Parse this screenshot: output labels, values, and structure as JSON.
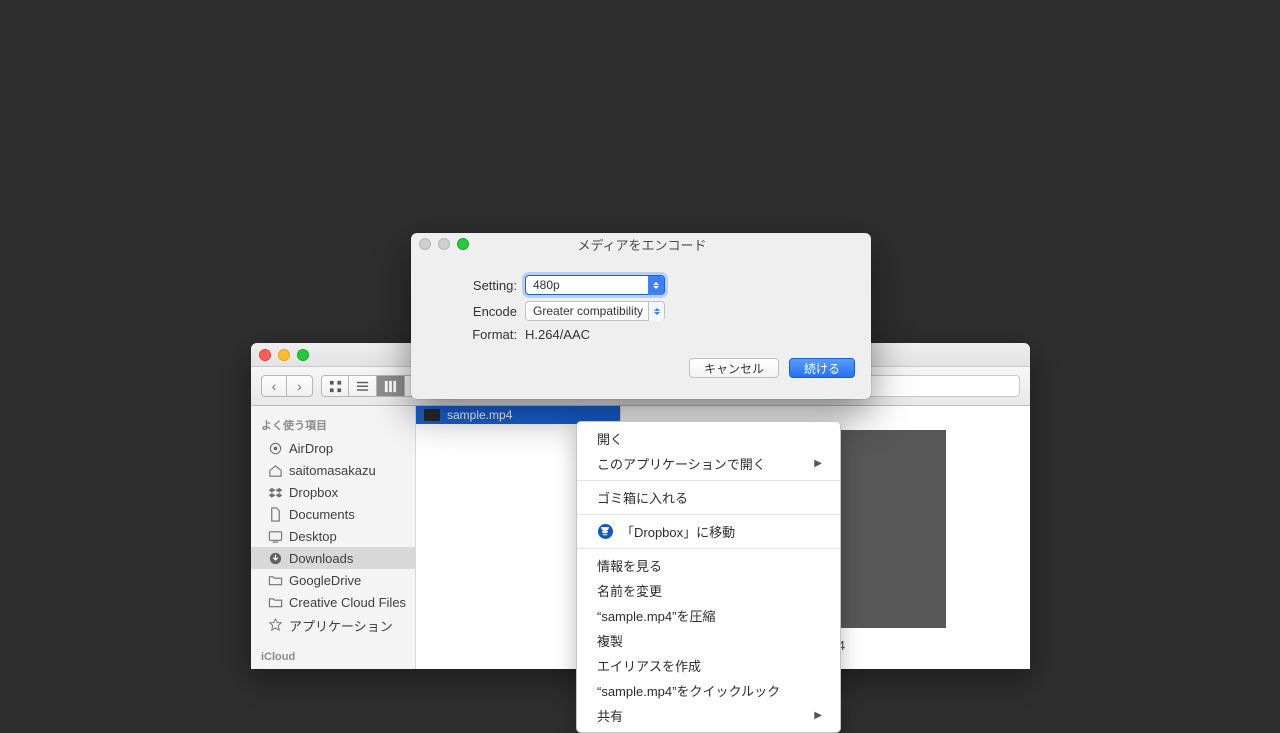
{
  "finder": {
    "sidebar": {
      "favorites_header": "よく使う項目",
      "icloud_header": "iCloud",
      "items": [
        {
          "icon": "airdrop",
          "label": "AirDrop"
        },
        {
          "icon": "home",
          "label": "saitomasakazu"
        },
        {
          "icon": "dropbox",
          "label": "Dropbox"
        },
        {
          "icon": "folder",
          "label": "Documents"
        },
        {
          "icon": "desktop",
          "label": "Desktop"
        },
        {
          "icon": "downloads",
          "label": "Downloads"
        },
        {
          "icon": "folder",
          "label": "GoogleDrive"
        },
        {
          "icon": "folder",
          "label": "Creative Cloud Files"
        },
        {
          "icon": "apps",
          "label": "アプリケーション"
        }
      ]
    },
    "selected_file": "sample.mp4",
    "preview_name": "sample.mp4"
  },
  "encode": {
    "title": "メディアをエンコード",
    "setting_label": "Setting:",
    "setting_value": "480p",
    "encode_label": "Encode",
    "encode_value": "Greater compatibility",
    "format_label": "Format:",
    "format_value": "H.264/AAC",
    "cancel": "キャンセル",
    "continue": "続ける"
  },
  "context_menu": {
    "open": "開く",
    "open_with": "このアプリケーションで開く",
    "trash": "ゴミ箱に入れる",
    "move_to_dropbox": "「Dropbox」に移動",
    "get_info": "情報を見る",
    "rename": "名前を変更",
    "compress": "“sample.mp4”を圧縮",
    "duplicate": "複製",
    "make_alias": "エイリアスを作成",
    "quick_look": "“sample.mp4”をクイックルック",
    "share": "共有"
  }
}
